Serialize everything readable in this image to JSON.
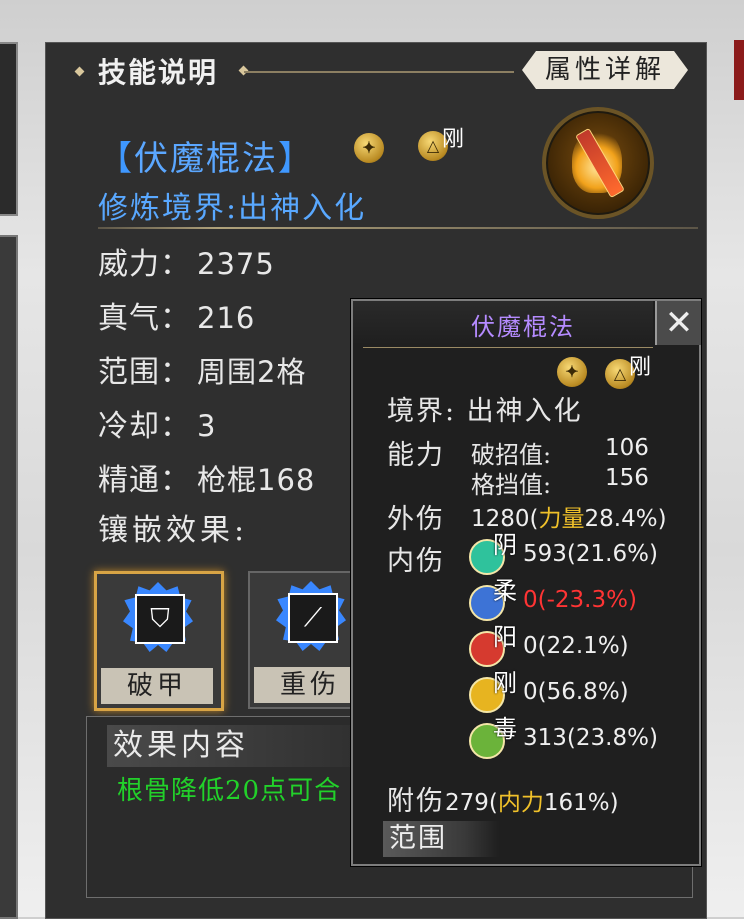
{
  "panel": {
    "title": "技能说明",
    "attr_button": "属性详解",
    "skill": {
      "name": "伏魔棍法",
      "bracket_open": "【",
      "bracket_close": "】",
      "attribute_label": "刚",
      "realm": "修炼境界:出神入化"
    },
    "stats": [
      {
        "label": "威力：",
        "value": "2375"
      },
      {
        "label": "真气：",
        "value": "216"
      },
      {
        "label": "范围：",
        "value": "周围2格"
      },
      {
        "label": "冷却：",
        "value": "3"
      },
      {
        "label": "精通：",
        "value": "枪棍168"
      }
    ],
    "inlay_title": "镶嵌效果:",
    "gems": [
      {
        "label": "破甲",
        "icon": "shield-icon"
      },
      {
        "label": "重伤",
        "icon": "blade-bleed-icon"
      }
    ],
    "effect": {
      "header": "效果内容",
      "text": "根骨降低20点可合"
    }
  },
  "tooltip": {
    "title": "伏魔棍法",
    "close": "✕",
    "attribute_label": "刚",
    "realm": "境界: 出神入化",
    "ability_label": "能力",
    "break_label": "破招值:",
    "break_value": "106",
    "block_label": "格挡值:",
    "block_value": "156",
    "outer_label": "外伤",
    "outer_value": "1280(",
    "outer_stat": "力量",
    "outer_pct": "28.4%)",
    "inner_label": "内伤",
    "inner_rows": [
      {
        "char": "阴",
        "value": "593(21.6%)",
        "color": "#2fc29c",
        "negative": false
      },
      {
        "char": "柔",
        "value": "0(-23.3%)",
        "color": "#3d73d6",
        "negative": true
      },
      {
        "char": "阳",
        "value": "0(22.1%)",
        "color": "#d63a2f",
        "negative": false
      },
      {
        "char": "刚",
        "value": "0(56.8%)",
        "color": "#e7b420",
        "negative": false
      },
      {
        "char": "毒",
        "value": "313(23.8%)",
        "color": "#6bb33a",
        "negative": false
      }
    ],
    "extra_label": "附伤",
    "extra_value": "279(",
    "extra_stat": "内力",
    "extra_pct": "161%)",
    "range_tab": "范围"
  },
  "colors": {
    "skill_name": "#5ba7ff",
    "tooltip_title": "#b58bff",
    "gold": "#f0c12a",
    "effect_text": "#22d12a",
    "negative": "#ff3434"
  }
}
